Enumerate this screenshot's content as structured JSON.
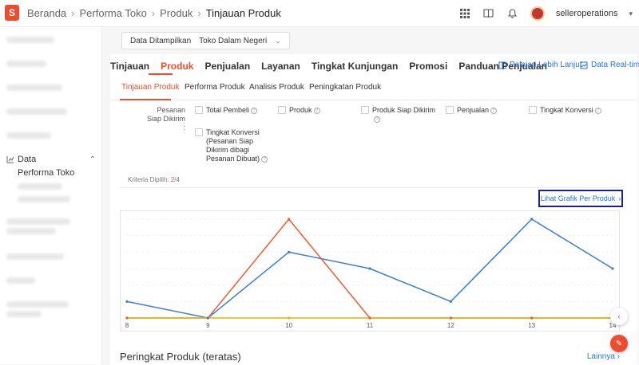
{
  "breadcrumb": [
    "Beranda",
    "Performa Toko",
    "Produk",
    "Tinjauan Produk"
  ],
  "user": {
    "name": "selleroperations"
  },
  "sidebar": {
    "section": "Data",
    "item": "Performa Toko"
  },
  "filter": {
    "label": "Data Ditampilkan",
    "value": "Toko Dalam Negeri"
  },
  "main_tabs": [
    "Tinjauan",
    "Produk",
    "Penjualan",
    "Layanan",
    "Tingkat Kunjungan",
    "Promosi",
    "Panduan Penjualan"
  ],
  "links": {
    "learn": "Pelajari Lebih Lanjut",
    "realtime": "Data Real-time"
  },
  "sub_tabs": [
    "Tinjauan Produk",
    "Performa Produk",
    "Analisis Produk",
    "Peningkatan Produk"
  ],
  "metrics": {
    "label": "Pesanan Siap Dikirim :",
    "options": [
      "Total Pembeli",
      "Produk",
      "Produk Siap Dikirim",
      "Penjualan",
      "Tingkat Konversi",
      "Tingkat Konversi (Pesanan Siap Dikirim dibagi Pesanan Dibuat)"
    ]
  },
  "criteria": {
    "label": "Kriteria Dipilih:",
    "selected": "2",
    "total": "/4"
  },
  "chart_button": "Lihat Grafik Per Produk",
  "chart_data": {
    "type": "line",
    "x": [
      "8",
      "9",
      "10",
      "11",
      "12",
      "13",
      "14"
    ],
    "ylim": [
      0,
      6
    ],
    "series": [
      {
        "color": "#3b7ddd",
        "values": [
          1,
          0,
          4,
          3,
          1,
          6,
          3
        ]
      },
      {
        "color": "#ee5a2f",
        "values": [
          0,
          0,
          6,
          0,
          0,
          0,
          0
        ]
      },
      {
        "color": "#e8b400",
        "values": [
          0,
          0,
          0,
          0,
          0,
          0,
          0
        ]
      }
    ]
  },
  "ranking": {
    "title": "Peringkat Produk (teratas)",
    "more": "Lainnya"
  },
  "colors": {
    "accent": "#ee4d2d",
    "link": "#2673dd"
  }
}
